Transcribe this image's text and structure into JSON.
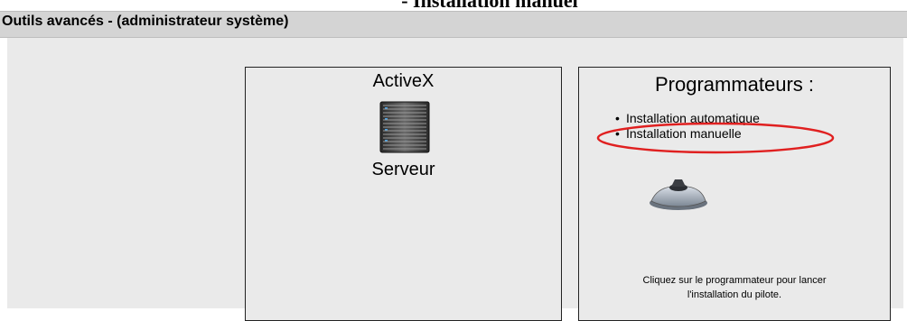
{
  "page": {
    "top_title": "- Installation manuel"
  },
  "header": {
    "title": "Outils avancés - (administrateur système)"
  },
  "activex_panel": {
    "title": "ActiveX",
    "icon": "server-icon",
    "label": "Serveur"
  },
  "programmer_panel": {
    "title": "Programmateurs :",
    "items": [
      {
        "label": "Installation automatique"
      },
      {
        "label": "Installation manuelle"
      }
    ],
    "highlight_color": "#e02020",
    "device_icon": "programmer-device-icon",
    "instructions_line1": "Cliquez sur le programmateur pour lancer",
    "instructions_line2": "l'installation du pilote."
  }
}
